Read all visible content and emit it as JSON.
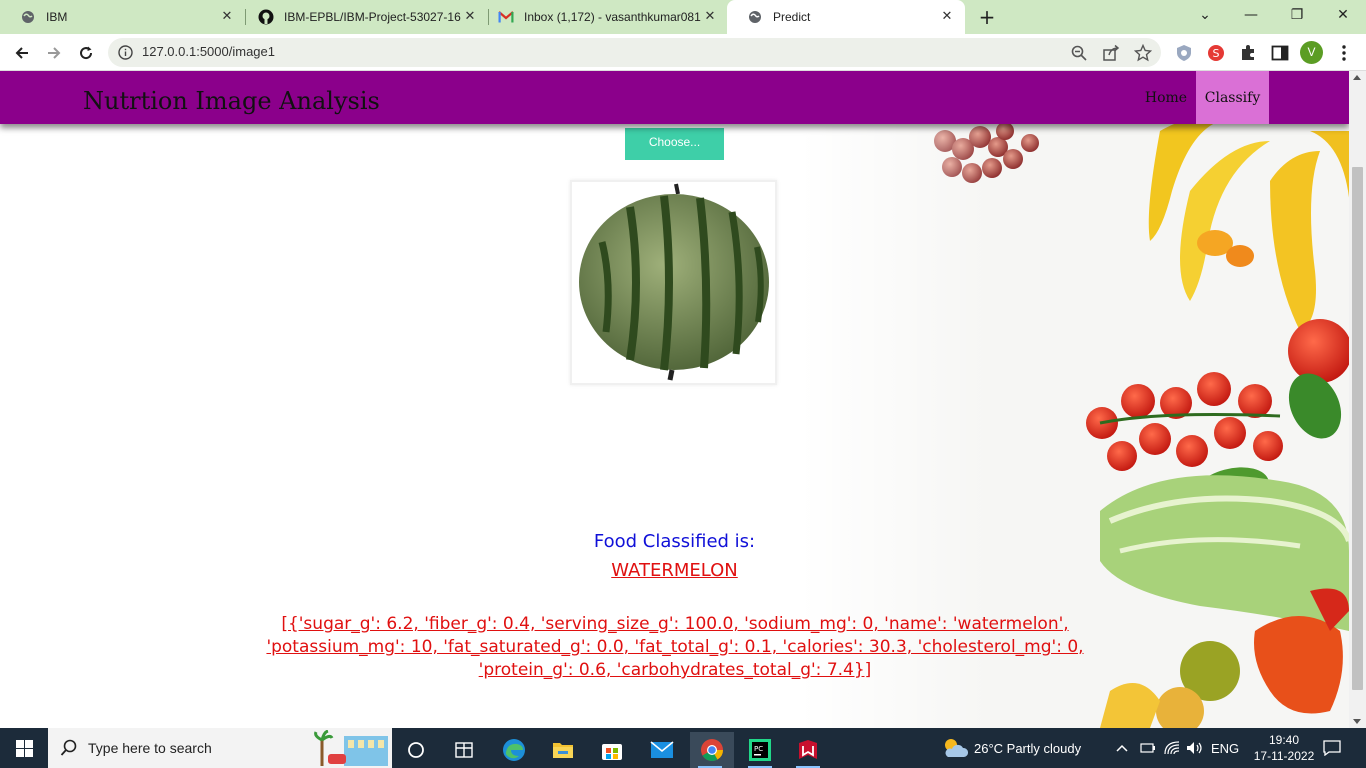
{
  "browser": {
    "tabs": [
      {
        "title": "IBM",
        "icon": "globe-icon"
      },
      {
        "title": "IBM-EPBL/IBM-Project-53027-16",
        "icon": "github-icon"
      },
      {
        "title": "Inbox (1,172) - vasanthkumar081",
        "icon": "gmail-icon"
      },
      {
        "title": "Predict",
        "icon": "globe-icon"
      }
    ],
    "url": "127.0.0.1:5000/image1",
    "profile_initial": "V"
  },
  "page": {
    "brand": "Nutrtion Image Analysis",
    "nav": {
      "home": "Home",
      "classify": "Classify"
    },
    "choose_label": "Choose...",
    "result_label": "Food Classified is:",
    "result_value": "WATERMELON",
    "nutrition_text": "[{'sugar_g': 6.2, 'fiber_g': 0.4, 'serving_size_g': 100.0, 'sodium_mg': 0, 'name': 'watermelon', 'potassium_mg': 10, 'fat_saturated_g': 0.0, 'fat_total_g': 0.1, 'calories': 30.3, 'cholesterol_mg': 0, 'protein_g': 0.6, 'carbohydrates_total_g': 7.4}]",
    "colors": {
      "navbar": "#8b008b",
      "active_nav": "#da70d6",
      "choose": "#3ecfa8",
      "label": "#1010d8",
      "value": "#e01010"
    }
  },
  "taskbar": {
    "search_placeholder": "Type here to search",
    "weather": "26°C  Partly cloudy",
    "language": "ENG",
    "time": "19:40",
    "date": "17-11-2022"
  }
}
